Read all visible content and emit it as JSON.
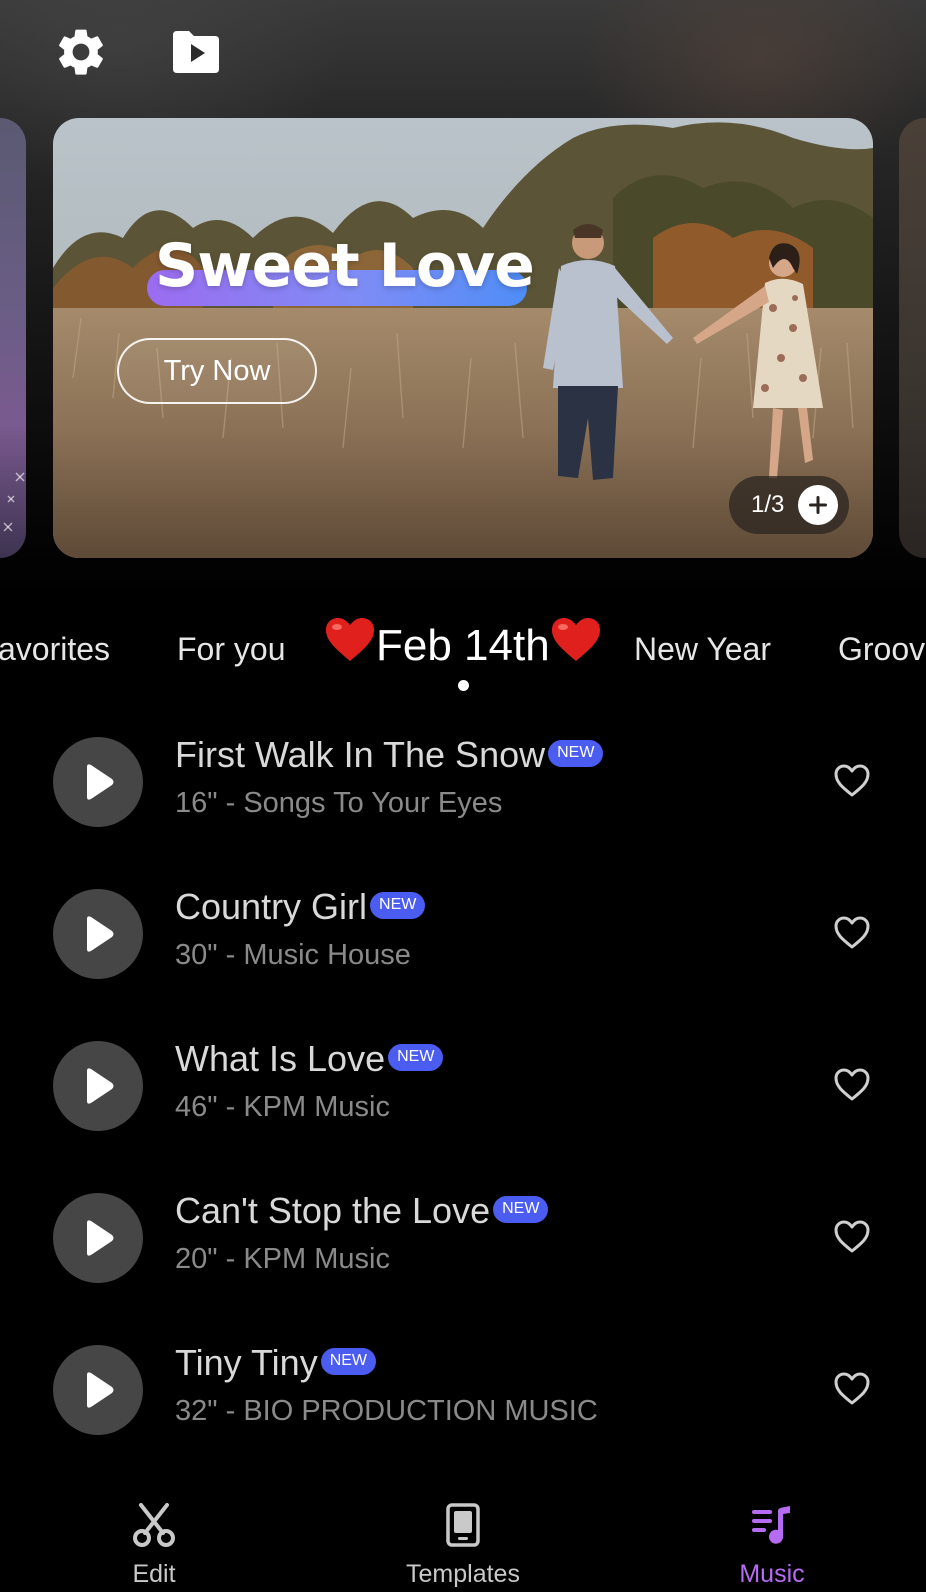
{
  "header": {
    "icons": [
      "gear-icon",
      "video-folder-icon"
    ]
  },
  "banner": {
    "title": "Sweet Love",
    "cta_label": "Try Now",
    "page_indicator": "1/3",
    "title_gradient": [
      "#9b6cf0",
      "#4f8df7"
    ]
  },
  "tabs": {
    "items": [
      {
        "label": "avorites"
      },
      {
        "label": "For you"
      },
      {
        "label": "Feb 14th",
        "active": true,
        "decoration": "❤️"
      },
      {
        "label": "New Year"
      },
      {
        "label": "Groov"
      }
    ]
  },
  "tracks": [
    {
      "title": "First Walk In The Snow",
      "badge": "NEW",
      "meta": "16\" - Songs To Your Eyes"
    },
    {
      "title": "Country Girl",
      "badge": "NEW",
      "meta": "30\" - Music House"
    },
    {
      "title": "What Is Love",
      "badge": "NEW",
      "meta": "46\" - KPM Music"
    },
    {
      "title": "Can't Stop the Love",
      "badge": "NEW",
      "meta": "20\" - KPM Music"
    },
    {
      "title": "Tiny Tiny",
      "badge": "NEW",
      "meta": "32\" - BIO PRODUCTION MUSIC"
    }
  ],
  "bottom_nav": {
    "items": [
      {
        "label": "Edit",
        "icon": "scissors-icon"
      },
      {
        "label": "Templates",
        "icon": "phone-template-icon"
      },
      {
        "label": "Music",
        "icon": "music-note-icon",
        "active": true
      }
    ]
  },
  "colors": {
    "accent": "#b66cf2",
    "new_badge": "#4b5cf0",
    "background": "#000000"
  }
}
